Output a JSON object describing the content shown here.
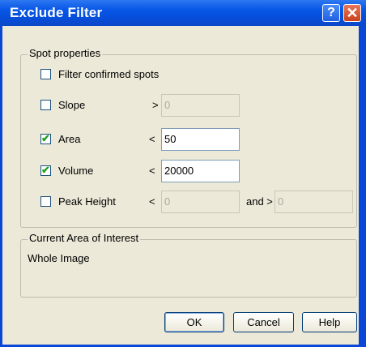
{
  "window": {
    "title": "Exclude Filter"
  },
  "titlebar": {
    "help_glyph": "?",
    "close_glyph": "✕"
  },
  "spot_properties": {
    "legend": "Spot properties",
    "filter_confirmed": {
      "label": "Filter confirmed spots",
      "checked": false
    },
    "slope": {
      "label": "Slope",
      "checked": false,
      "operator": ">",
      "value": "0",
      "enabled": false
    },
    "area": {
      "label": "Area",
      "checked": true,
      "operator": "<",
      "value": "50",
      "enabled": true
    },
    "volume": {
      "label": "Volume",
      "checked": true,
      "operator": "<",
      "value": "20000",
      "enabled": true
    },
    "peak_height": {
      "label": "Peak Height",
      "checked": false,
      "operator": "<",
      "value": "0",
      "enabled": false,
      "and_label": "and >",
      "value2": "0"
    }
  },
  "area_of_interest": {
    "legend": "Current Area of Interest",
    "value": "Whole Image"
  },
  "buttons": {
    "ok": "OK",
    "cancel": "Cancel",
    "help": "Help"
  },
  "check_mark": "✔"
}
